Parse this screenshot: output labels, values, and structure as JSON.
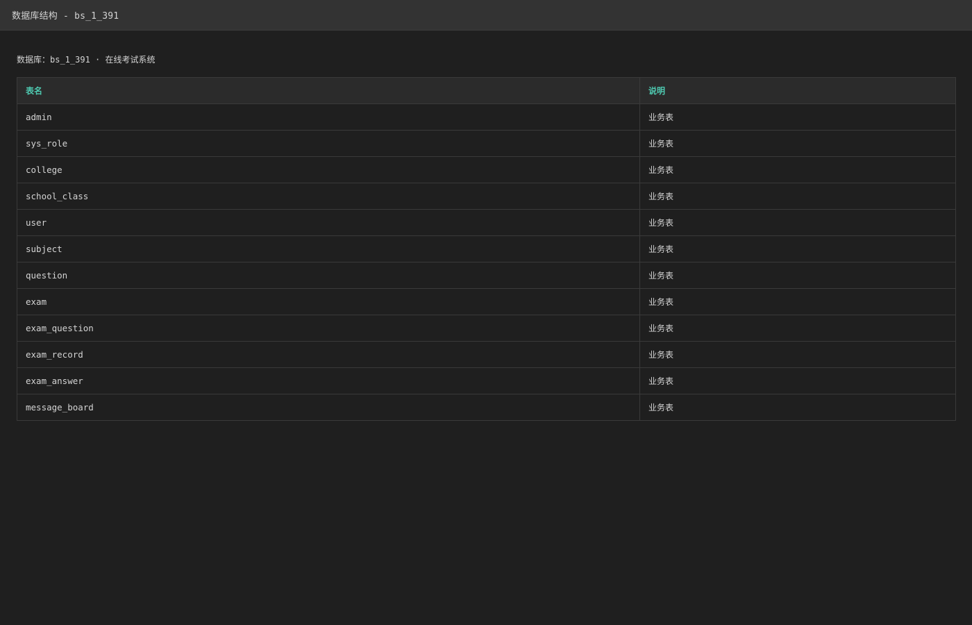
{
  "window": {
    "title": "数据库结构 - bs_1_391"
  },
  "database": {
    "info": "数据库：bs_1_391 · 在线考试系统"
  },
  "table": {
    "columns": [
      "表名",
      "说明"
    ],
    "rows": [
      {
        "name": "admin",
        "desc": "业务表"
      },
      {
        "name": "sys_role",
        "desc": "业务表"
      },
      {
        "name": "college",
        "desc": "业务表"
      },
      {
        "name": "school_class",
        "desc": "业务表"
      },
      {
        "name": "user",
        "desc": "业务表"
      },
      {
        "name": "subject",
        "desc": "业务表"
      },
      {
        "name": "question",
        "desc": "业务表"
      },
      {
        "name": "exam",
        "desc": "业务表"
      },
      {
        "name": "exam_question",
        "desc": "业务表"
      },
      {
        "name": "exam_record",
        "desc": "业务表"
      },
      {
        "name": "exam_answer",
        "desc": "业务表"
      },
      {
        "name": "message_board",
        "desc": "业务表"
      }
    ]
  },
  "colors": {
    "background": "#1f1f1f",
    "titlebar": "#333333",
    "header_accent": "#4ec9b0",
    "border": "#3a3a3a"
  }
}
